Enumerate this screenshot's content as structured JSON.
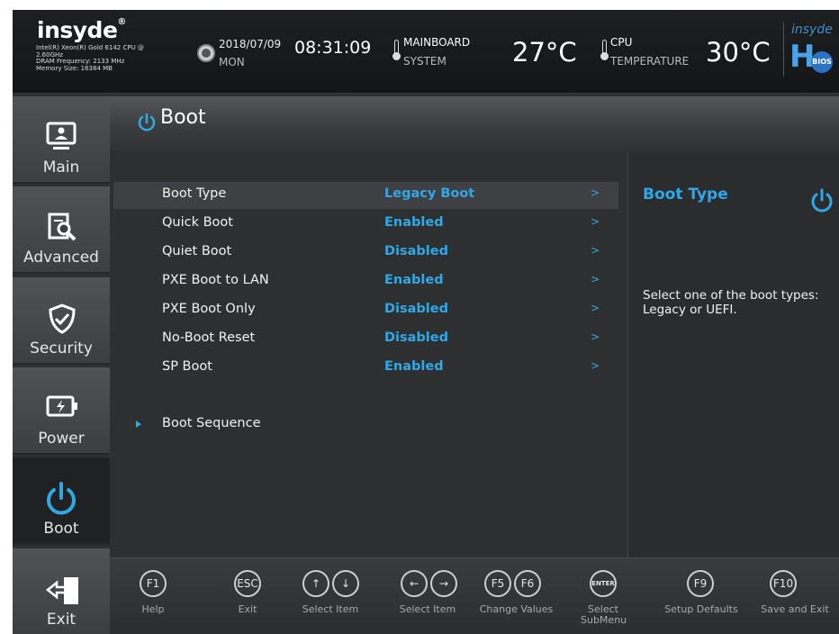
{
  "header": {
    "logo": "insyde",
    "logo_tm": "®",
    "cpu_info_1": "Intel(R) Xeon(R) Gold 6142 CPU @",
    "cpu_info_2": "2.60GHz",
    "dram": "DRAM Frequency: 2133 MHz",
    "memory": "Memory Size: 16384 MB",
    "date": "2018/07/09",
    "day": "MON",
    "time": "08:31:09",
    "mainboard_label_1": "MAINBOARD",
    "mainboard_label_2": "SYSTEM",
    "mainboard_temp": "27°C",
    "cpu_label_1": "CPU",
    "cpu_label_2": "TEMPERATURE",
    "cpu_temp": "30°C",
    "brand_small": "insyde",
    "brand_h": "H",
    "brand_bios": "BIOS"
  },
  "sidebar": [
    {
      "label": "Main",
      "icon": "monitor-user-icon"
    },
    {
      "label": "Advanced",
      "icon": "advanced-icon"
    },
    {
      "label": "Security",
      "icon": "shield-icon"
    },
    {
      "label": "Power",
      "icon": "battery-icon"
    },
    {
      "label": "Boot",
      "icon": "power-icon",
      "active": true
    },
    {
      "label": "Exit",
      "icon": "exit-door-icon"
    }
  ],
  "page": {
    "title": "Boot"
  },
  "settings": [
    {
      "name": "Boot Type",
      "value": "Legacy Boot",
      "arrow": ">"
    },
    {
      "name": "Quick Boot",
      "value": "Enabled",
      "arrow": ">"
    },
    {
      "name": "Quiet Boot",
      "value": "Disabled",
      "arrow": ">"
    },
    {
      "name": "PXE Boot to LAN",
      "value": "Enabled",
      "arrow": ">"
    },
    {
      "name": "PXE Boot Only",
      "value": "Disabled",
      "arrow": ">"
    },
    {
      "name": "No-Boot Reset",
      "value": "Disabled",
      "arrow": ">"
    },
    {
      "name": "SP Boot",
      "value": "Enabled",
      "arrow": ">"
    }
  ],
  "submenu": {
    "label": "Boot Sequence"
  },
  "help": {
    "title": "Boot Type",
    "line1": "Select one of the boot types:",
    "line2": "Legacy or UEFI."
  },
  "footer": {
    "f1": "F1",
    "help": "Help",
    "esc": "ESC",
    "exit": "Exit",
    "up": "↑",
    "down": "↓",
    "select_item_1": "Select Item",
    "left": "←",
    "right": "→",
    "select_item_2": "Select Item",
    "f5": "F5",
    "f6": "F6",
    "change_values": "Change Values",
    "enter": "ENTER",
    "select_1": "Select",
    "select_2": "SubMenu",
    "f9": "F9",
    "setup_defaults": "Setup Defaults",
    "f10": "F10",
    "save_exit": "Save and Exit"
  },
  "colors": {
    "accent": "#2fa8e6",
    "background": "#2e2f31",
    "selected_row": "#3f4043"
  }
}
